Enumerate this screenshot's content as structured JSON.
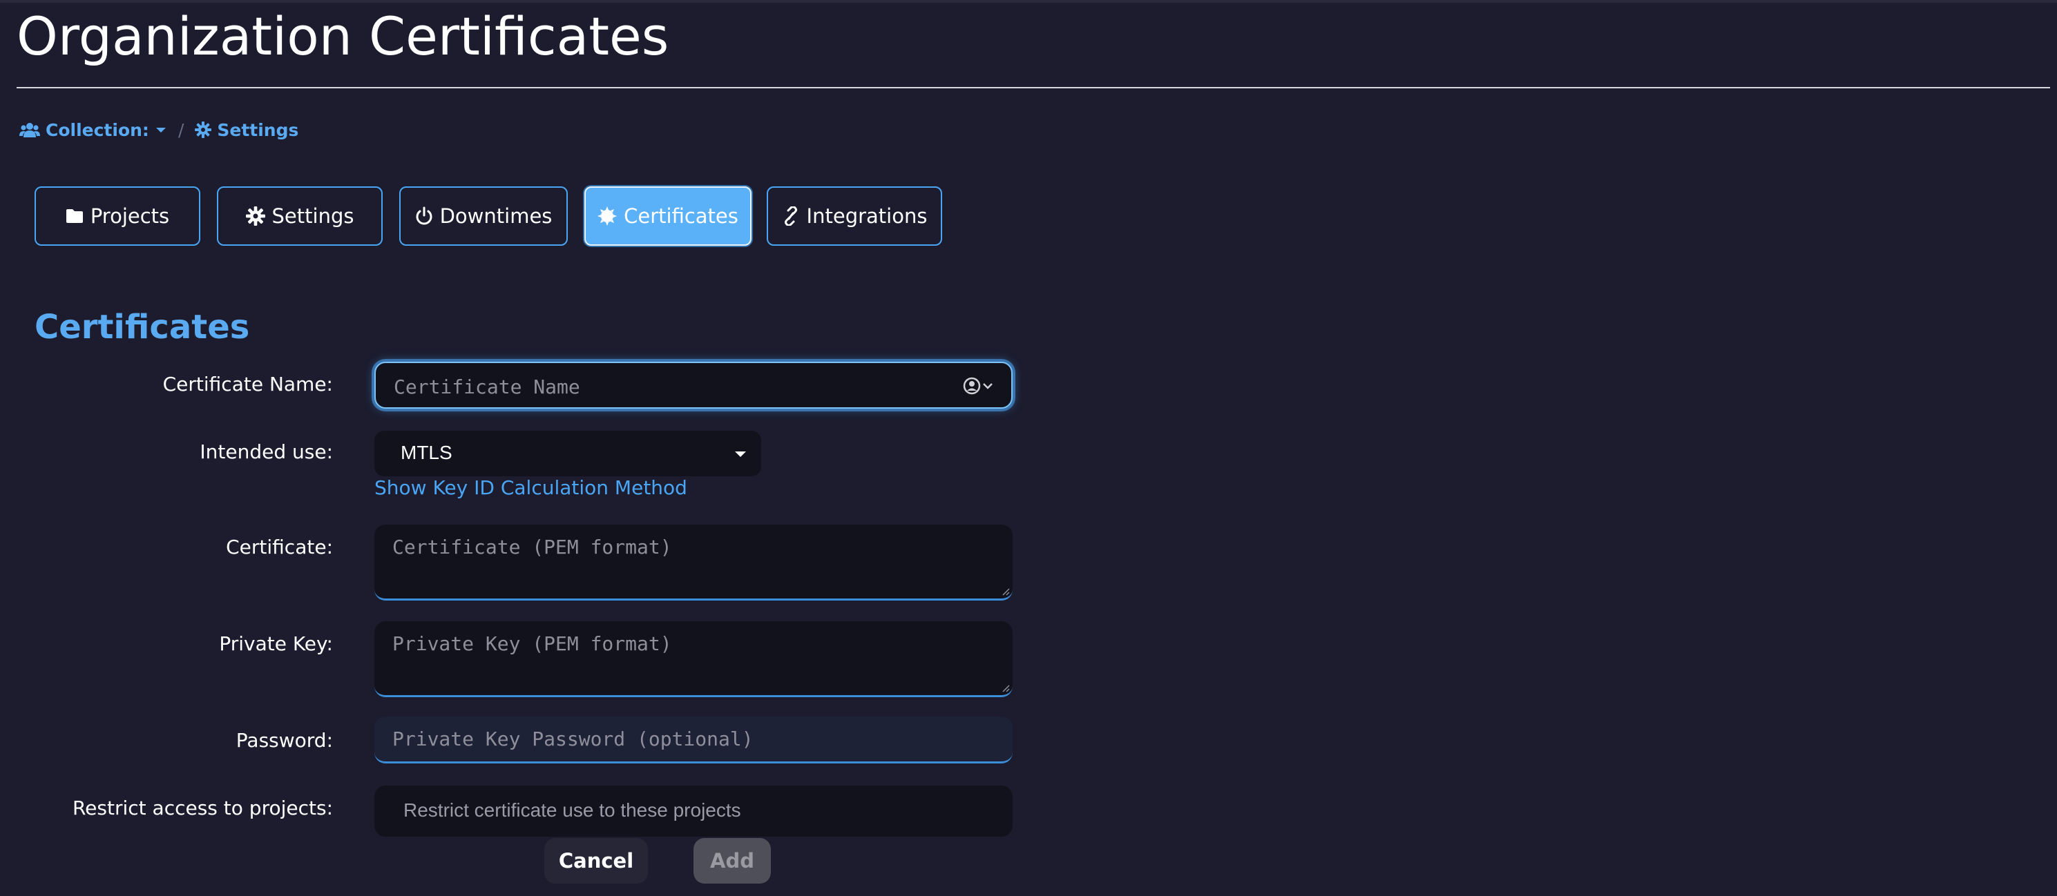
{
  "page": {
    "title": "Organization Certificates"
  },
  "breadcrumb": {
    "collection_label": "Collection:",
    "settings_label": "Settings"
  },
  "tabs": [
    {
      "label": "Projects",
      "icon": "folder-icon",
      "active": false
    },
    {
      "label": "Settings",
      "icon": "gear-icon",
      "active": false
    },
    {
      "label": "Downtimes",
      "icon": "power-icon",
      "active": false
    },
    {
      "label": "Certificates",
      "icon": "certificate-icon",
      "active": true
    },
    {
      "label": "Integrations",
      "icon": "link-icon",
      "active": false
    }
  ],
  "section": {
    "title": "Certificates"
  },
  "form": {
    "name": {
      "label": "Certificate Name:",
      "value": "",
      "placeholder": "Certificate Name"
    },
    "intended_use": {
      "label": "Intended use:",
      "selected": "MTLS"
    },
    "key_id_link": "Show Key ID Calculation Method",
    "certificate": {
      "label": "Certificate:",
      "value": "",
      "placeholder": "Certificate (PEM format)"
    },
    "private_key": {
      "label": "Private Key:",
      "value": "",
      "placeholder": "Private Key (PEM format)"
    },
    "password": {
      "label": "Password:",
      "value": "",
      "placeholder": "Private Key Password (optional)"
    },
    "restrict": {
      "label": "Restrict access to projects:",
      "placeholder": "Restrict certificate use to these projects"
    }
  },
  "buttons": {
    "cancel": "Cancel",
    "add": "Add"
  },
  "colors": {
    "background": "#1c1c2e",
    "accent": "#4aa6f5",
    "active_tab": "#5bb1f7",
    "field_bg": "#12121c"
  }
}
